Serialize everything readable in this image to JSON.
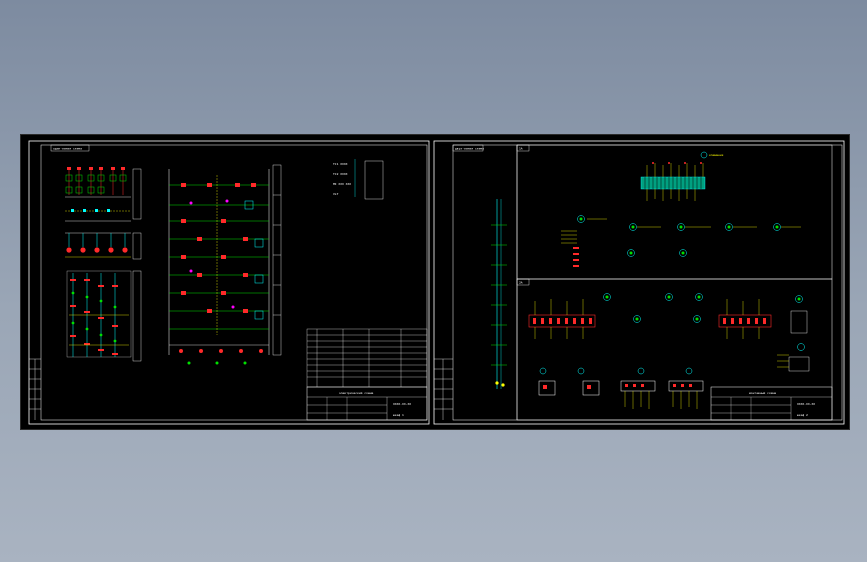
{
  "left_sheet": {
    "title_tag": "один-линия схема",
    "title_block": {
      "caption": "электрический схема",
      "drawing_no": "XXXX-XX-XX",
      "sheet_label": "шкаф 1"
    }
  },
  "right_sheet": {
    "title_tag": "двух-линия схема",
    "panel_upper_tag": "1A",
    "panel_lower_tag": "2A",
    "terminal_block_caption": "клеммник",
    "title_block": {
      "caption": "монтажный схема",
      "drawing_no": "XXXX-XX-XX",
      "sheet_label": "шкаф 2"
    }
  },
  "legend": {
    "rows": [
      "TC1 XXXX",
      "TC2 XXXX",
      "MI XXX XXX",
      "VLT"
    ]
  },
  "colors": {
    "frame": "#ffffff",
    "red": "#ff2a2a",
    "green": "#00e000",
    "yellow": "#ffff00",
    "cyan": "#00ffff",
    "magenta": "#ff00ff",
    "blue": "#3060ff",
    "background": "#000000"
  }
}
